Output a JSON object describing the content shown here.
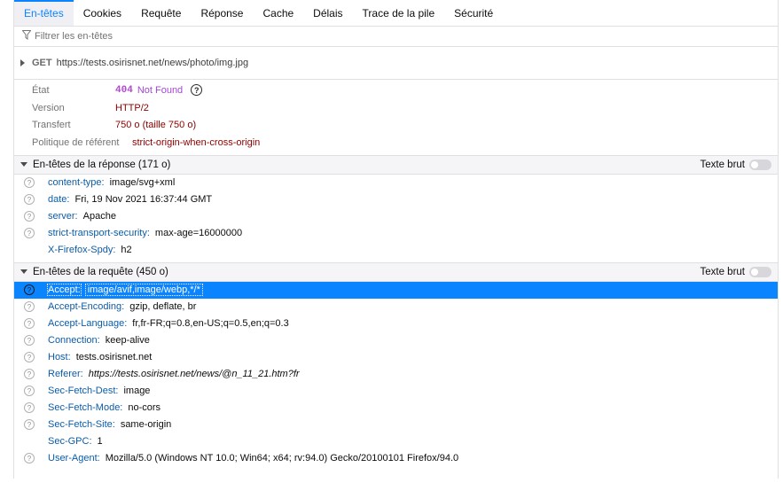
{
  "tabs": [
    {
      "label": "En-têtes",
      "active": true
    },
    {
      "label": "Cookies",
      "active": false
    },
    {
      "label": "Requête",
      "active": false
    },
    {
      "label": "Réponse",
      "active": false
    },
    {
      "label": "Cache",
      "active": false
    },
    {
      "label": "Délais",
      "active": false
    },
    {
      "label": "Trace de la pile",
      "active": false
    },
    {
      "label": "Sécurité",
      "active": false
    }
  ],
  "filter": {
    "placeholder": "Filtrer les en-têtes",
    "icon": "funnel-icon"
  },
  "request": {
    "method": "GET",
    "url": "https://tests.osirisnet.net/news/photo/img.jpg"
  },
  "summary": {
    "status_label": "État",
    "status_code": "404",
    "status_text": "Not Found",
    "version_label": "Version",
    "version_value": "HTTP/2",
    "transfer_label": "Transfert",
    "transfer_value": "750 o (taille 750 o)",
    "referrer_label": "Politique de référent",
    "referrer_value": "strict-origin-when-cross-origin"
  },
  "response_section": {
    "title": "En-têtes de la réponse (171 o)",
    "raw_label": "Texte brut",
    "raw_enabled": false,
    "headers": [
      {
        "name": "content-type:",
        "value": "image/svg+xml",
        "help": true
      },
      {
        "name": "date:",
        "value": "Fri, 19 Nov 2021 16:37:44 GMT",
        "help": true
      },
      {
        "name": "server:",
        "value": "Apache",
        "help": true
      },
      {
        "name": "strict-transport-security:",
        "value": "max-age=16000000",
        "help": true
      },
      {
        "name": "X-Firefox-Spdy:",
        "value": "h2",
        "help": false
      }
    ]
  },
  "request_section": {
    "title": "En-têtes de la requête (450 o)",
    "raw_label": "Texte brut",
    "raw_enabled": false,
    "headers": [
      {
        "name": "Accept:",
        "value": "image/avif,image/webp,*/*",
        "help": true,
        "selected": true
      },
      {
        "name": "Accept-Encoding:",
        "value": "gzip, deflate, br",
        "help": true
      },
      {
        "name": "Accept-Language:",
        "value": "fr,fr-FR;q=0.8,en-US;q=0.5,en;q=0.3",
        "help": true
      },
      {
        "name": "Connection:",
        "value": "keep-alive",
        "help": true
      },
      {
        "name": "Host:",
        "value": "tests.osirisnet.net",
        "help": true
      },
      {
        "name": "Referer:",
        "value": "https://tests.osirisnet.net/news/@n_11_21.htm?fr",
        "help": true,
        "italic": true
      },
      {
        "name": "Sec-Fetch-Dest:",
        "value": "image",
        "help": true
      },
      {
        "name": "Sec-Fetch-Mode:",
        "value": "no-cors",
        "help": true
      },
      {
        "name": "Sec-Fetch-Site:",
        "value": "same-origin",
        "help": true
      },
      {
        "name": "Sec-GPC:",
        "value": "1",
        "help": false
      },
      {
        "name": "User-Agent:",
        "value": "Mozilla/5.0 (Windows NT 10.0; Win64; x64; rv:94.0) Gecko/20100101 Firefox/94.0",
        "help": true
      }
    ]
  },
  "colors": {
    "accent": "#0a84ff",
    "header_name": "#0b5ca9",
    "summary_value": "#8b0000",
    "status": "#a546d4"
  }
}
